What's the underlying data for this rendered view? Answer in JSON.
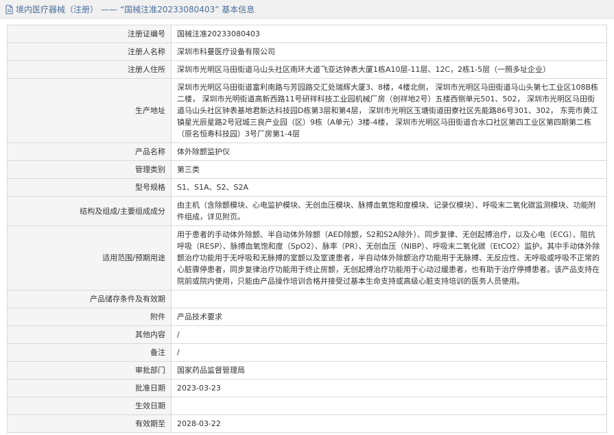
{
  "header": {
    "category": "境内医疗器械（注册）",
    "separator": "——",
    "title": "“国械注准20233080403” 基本信息"
  },
  "rows": [
    {
      "label": "注册证编号",
      "value": "国械注准20233080403"
    },
    {
      "label": "注册人名称",
      "value": "深圳市科曼医疗设备有限公司"
    },
    {
      "label": "注册人住所",
      "value": "深圳市光明区马田街道马山头社区南环大道飞亚达钟表大厦1栋A10层-11层、12C，2栋1-5层（一照多址企业）"
    },
    {
      "label": "生产地址",
      "value": "深圳市光明区马田街道富利南路与芳园路交汇处瑞辉大厦3、8楼，4楼北侧， 深圳市光明区马田街道马山头第七工业区108B栋二楼， 深圳市光明街道高新西路11号研祥科技工业园机械厂房（创祥地2号）五楼西侧单元501、502， 深圳市光明区马田街道马山头社区钟表基地君新达科技园D栋第3层和第4层， 深圳市光明区玉塘街道田寮社区先能路86号301、302， 东莞市黄江镇星光辰星路2号冠城三良产业园（区）9栋（A单元）3楼-4楼， 深圳市光明区马田街道合水口社区第四工业区第四期第二栋（原名恒寿科技园）3号厂房第1-4层"
    },
    {
      "label": "产品名称",
      "value": "体外除颤监护仪"
    },
    {
      "label": "管理类别",
      "value": "第三类"
    },
    {
      "label": "型号规格",
      "value": "S1、S1A、S2、S2A"
    },
    {
      "label": "结构及组成/主要组成成分",
      "value": "由主机（含除颤模块、心电监护模块、无创血压模块、脉搏血氧饱和度模块、记录仪模块）、呼吸末二氧化碳监测模块、功能附件组成，详见附页。"
    },
    {
      "label": "适用范围/预期用途",
      "value": "用于患者的手动体外除颤、半自动体外除颤（AED除颤，S2和S2A除外）、同步复律、无创起搏治疗，以及心电（ECG）、阻抗呼吸（RESP）、脉搏血氧饱和度（SpO2）、脉率（PR）、无创血压（NIBP）、呼吸末二氧化碳（EtCO2）监护。其中手动体外除颤治疗功能用于无呼吸和无脉搏的室颤以及室速患者，半自动体外除颤治疗功能用于无脉搏、无反应性、无呼吸或呼吸不正常的心脏骤停患者，同步复律治疗功能用于终止房颤，无创起搏治疗功能用于心动过缓患者，也有助于治疗停搏患者。该产品支持在院前或院内使用，只能由产品操作培训合格并接受过基本生命支持或高级心脏支持培训的医务人员使用。"
    },
    {
      "label": "产品储存条件及有效期",
      "value": ""
    },
    {
      "label": "附件",
      "value": "产品技术要求"
    },
    {
      "label": "其他内容",
      "value": "/"
    },
    {
      "label": "备注",
      "value": "/"
    },
    {
      "label": "审批部门",
      "value": "国家药品监督管理局"
    },
    {
      "label": "批准日期",
      "value": "2023-03-23"
    },
    {
      "label": "生效日期",
      "value": ""
    },
    {
      "label": "有效期至",
      "value": "2028-03-22"
    }
  ]
}
